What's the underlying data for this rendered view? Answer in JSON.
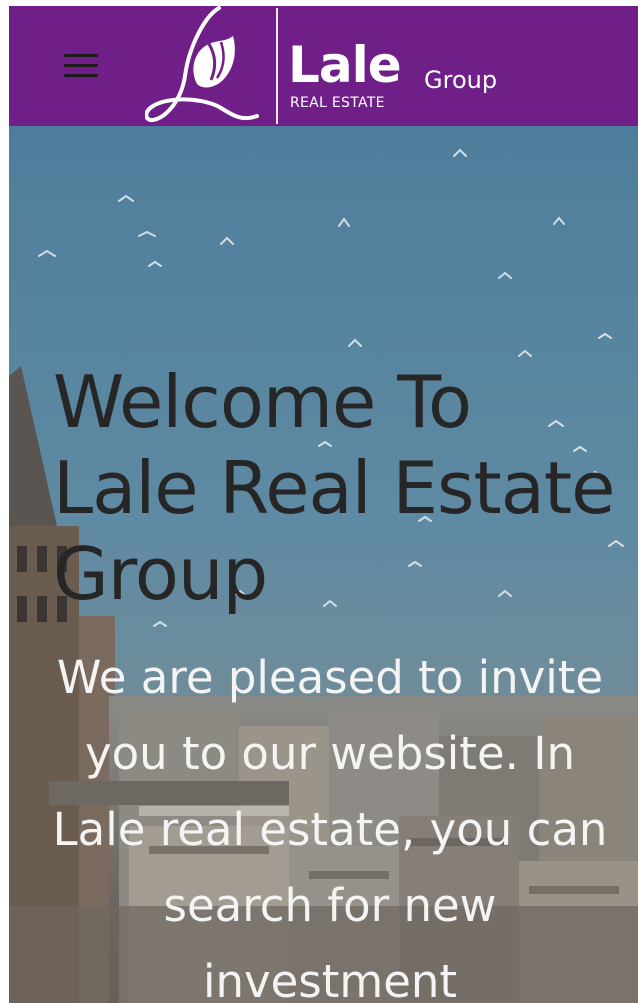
{
  "header": {
    "background_color": "#6f1f87",
    "menu_icon": "hamburger-menu-icon",
    "logo": {
      "mark_icon": "tulip-logo-icon",
      "name": "Lale",
      "group": "Group",
      "subtitle": "REAL ESTATE"
    }
  },
  "hero": {
    "title": "Welcome To Lale Real Estate Group",
    "text": "We are pleased to invite you to our website. In Lale real estate, you can search for new investment"
  }
}
